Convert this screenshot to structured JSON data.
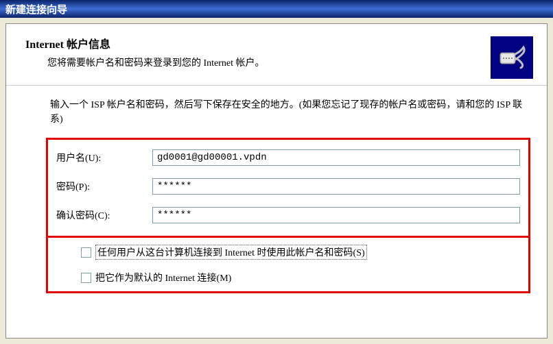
{
  "titlebar": {
    "title": "新建连接向导"
  },
  "header": {
    "title": "Internet 帐户信息",
    "subtitle": "您将需要帐户名和密码来登录到您的 Internet 帐户。"
  },
  "instruction": "输入一个 ISP 帐户名和密码，然后写下保存在安全的地方。(如果您忘记了现存的帐户名或密码，请和您的 ISP 联系)",
  "form": {
    "username_label": "用户名(U):",
    "username_value": "gd0001@gd00001.vpdn",
    "password_label": "密码(P):",
    "password_value": "******",
    "confirm_label": "确认密码(C):",
    "confirm_value": "******"
  },
  "checkboxes": {
    "anyone_label": "任何用户从这台计算机连接到 Internet 时使用此帐户名和密码(S)",
    "default_label": "把它作为默认的 Internet 连接(M)"
  }
}
